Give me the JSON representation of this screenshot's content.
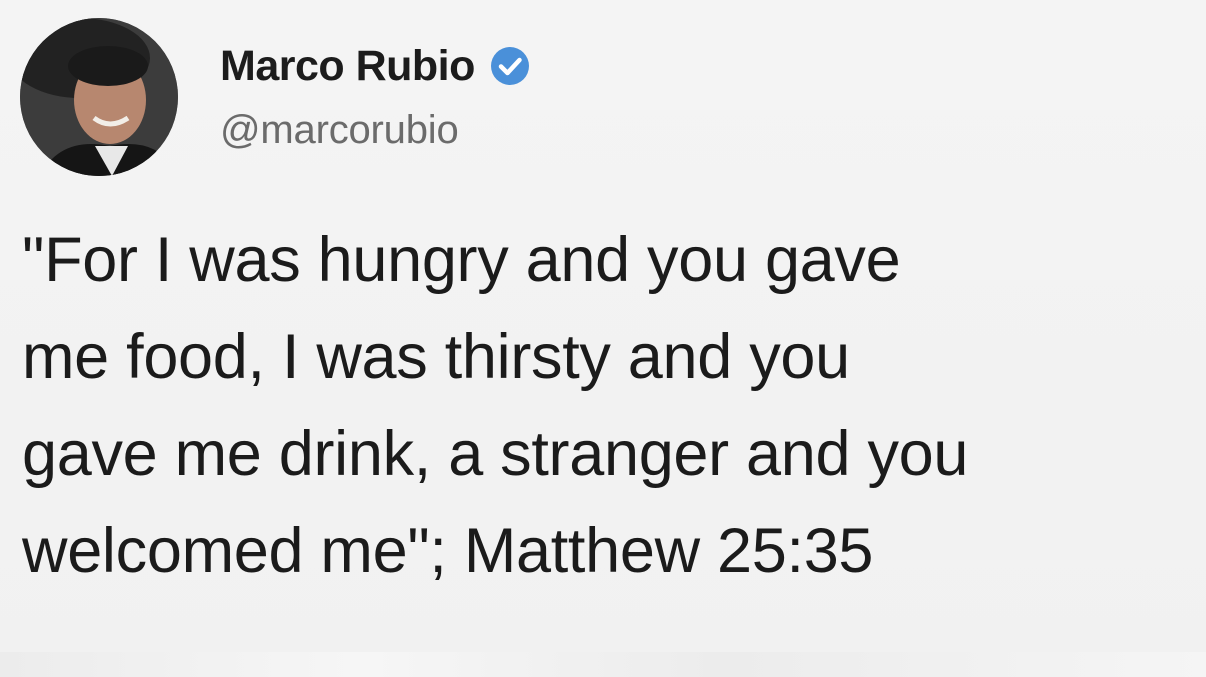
{
  "author": {
    "name": "Marco Rubio",
    "handle": "@marcorubio",
    "verified_icon": "verified-badge-icon",
    "avatar_icon": "profile-photo"
  },
  "tweet": {
    "lines": [
      "\"For I was hungry and you gave",
      "me food, I was thirsty and you",
      "gave me drink, a stranger and you",
      "welcomed me\"; Matthew 25:35"
    ]
  },
  "colors": {
    "verified_badge": "#4a90d9",
    "text": "#1b1b1b",
    "handle": "#6b6b6b",
    "background": "#f2f2f2"
  }
}
